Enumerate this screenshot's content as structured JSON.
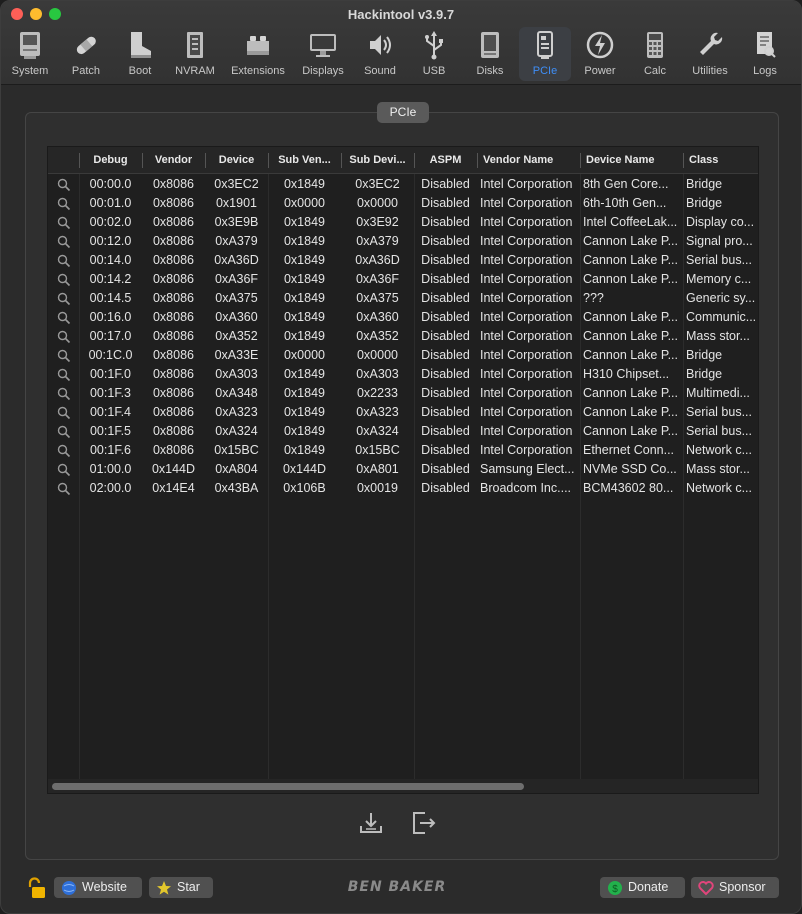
{
  "window": {
    "title": "Hackintool v3.9.7"
  },
  "toolbar": {
    "items": [
      {
        "label": "System",
        "icon": "computer-icon"
      },
      {
        "label": "Patch",
        "icon": "bandage-icon"
      },
      {
        "label": "Boot",
        "icon": "boot-icon"
      },
      {
        "label": "NVRAM",
        "icon": "nvram-chip-icon"
      },
      {
        "label": "Extensions",
        "icon": "lego-brick-icon"
      },
      {
        "label": "Displays",
        "icon": "monitor-icon"
      },
      {
        "label": "Sound",
        "icon": "speaker-icon"
      },
      {
        "label": "USB",
        "icon": "usb-icon"
      },
      {
        "label": "Disks",
        "icon": "disk-icon"
      },
      {
        "label": "PCIe",
        "icon": "pcie-card-icon",
        "active": true
      },
      {
        "label": "Power",
        "icon": "power-bolt-icon"
      },
      {
        "label": "Calc",
        "icon": "calculator-icon"
      },
      {
        "label": "Utilities",
        "icon": "wrench-icon"
      },
      {
        "label": "Logs",
        "icon": "log-document-icon"
      }
    ]
  },
  "group": {
    "title": "PCIe"
  },
  "table": {
    "columns": [
      "",
      "Debug",
      "Vendor",
      "Device",
      "Sub Ven...",
      "Sub Devi...",
      "ASPM",
      "Vendor Name",
      "Device Name",
      "Class"
    ],
    "rows": [
      [
        "00:00.0",
        "0x8086",
        "0x3EC2",
        "0x1849",
        "0x3EC2",
        "Disabled",
        "Intel Corporation",
        "8th Gen Core...",
        "Bridge"
      ],
      [
        "00:01.0",
        "0x8086",
        "0x1901",
        "0x0000",
        "0x0000",
        "Disabled",
        "Intel Corporation",
        "6th-10th Gen...",
        "Bridge"
      ],
      [
        "00:02.0",
        "0x8086",
        "0x3E9B",
        "0x1849",
        "0x3E92",
        "Disabled",
        "Intel Corporation",
        "Intel CoffeeLak...",
        "Display co..."
      ],
      [
        "00:12.0",
        "0x8086",
        "0xA379",
        "0x1849",
        "0xA379",
        "Disabled",
        "Intel Corporation",
        "Cannon Lake P...",
        "Signal pro..."
      ],
      [
        "00:14.0",
        "0x8086",
        "0xA36D",
        "0x1849",
        "0xA36D",
        "Disabled",
        "Intel Corporation",
        "Cannon Lake P...",
        "Serial bus..."
      ],
      [
        "00:14.2",
        "0x8086",
        "0xA36F",
        "0x1849",
        "0xA36F",
        "Disabled",
        "Intel Corporation",
        "Cannon Lake P...",
        "Memory c..."
      ],
      [
        "00:14.5",
        "0x8086",
        "0xA375",
        "0x1849",
        "0xA375",
        "Disabled",
        "Intel Corporation",
        "???",
        "Generic sy..."
      ],
      [
        "00:16.0",
        "0x8086",
        "0xA360",
        "0x1849",
        "0xA360",
        "Disabled",
        "Intel Corporation",
        "Cannon Lake P...",
        "Communic..."
      ],
      [
        "00:17.0",
        "0x8086",
        "0xA352",
        "0x1849",
        "0xA352",
        "Disabled",
        "Intel Corporation",
        "Cannon Lake P...",
        "Mass stor..."
      ],
      [
        "00:1C.0",
        "0x8086",
        "0xA33E",
        "0x0000",
        "0x0000",
        "Disabled",
        "Intel Corporation",
        "Cannon Lake P...",
        "Bridge"
      ],
      [
        "00:1F.0",
        "0x8086",
        "0xA303",
        "0x1849",
        "0xA303",
        "Disabled",
        "Intel Corporation",
        "H310 Chipset...",
        "Bridge"
      ],
      [
        "00:1F.3",
        "0x8086",
        "0xA348",
        "0x1849",
        "0x2233",
        "Disabled",
        "Intel Corporation",
        "Cannon Lake P...",
        "Multimedi..."
      ],
      [
        "00:1F.4",
        "0x8086",
        "0xA323",
        "0x1849",
        "0xA323",
        "Disabled",
        "Intel Corporation",
        "Cannon Lake P...",
        "Serial bus..."
      ],
      [
        "00:1F.5",
        "0x8086",
        "0xA324",
        "0x1849",
        "0xA324",
        "Disabled",
        "Intel Corporation",
        "Cannon Lake P...",
        "Serial bus..."
      ],
      [
        "00:1F.6",
        "0x8086",
        "0x15BC",
        "0x1849",
        "0x15BC",
        "Disabled",
        "Intel Corporation",
        "Ethernet Conn...",
        "Network c..."
      ],
      [
        "01:00.0",
        "0x144D",
        "0xA804",
        "0x144D",
        "0xA801",
        "Disabled",
        "Samsung Elect...",
        "NVMe SSD Co...",
        "Mass stor..."
      ],
      [
        "02:00.0",
        "0x14E4",
        "0x43BA",
        "0x106B",
        "0x0019",
        "Disabled",
        "Broadcom Inc....",
        "BCM43602 80...",
        "Network c..."
      ]
    ]
  },
  "footer": {
    "website_label": "Website",
    "star_label": "Star",
    "brand": "BEN BAKER",
    "donate_label": "Donate",
    "sponsor_label": "Sponsor"
  },
  "colors": {
    "accent": "#3e8ef7",
    "background": "#2b2b2b",
    "table_bg": "#1f1f1f"
  }
}
